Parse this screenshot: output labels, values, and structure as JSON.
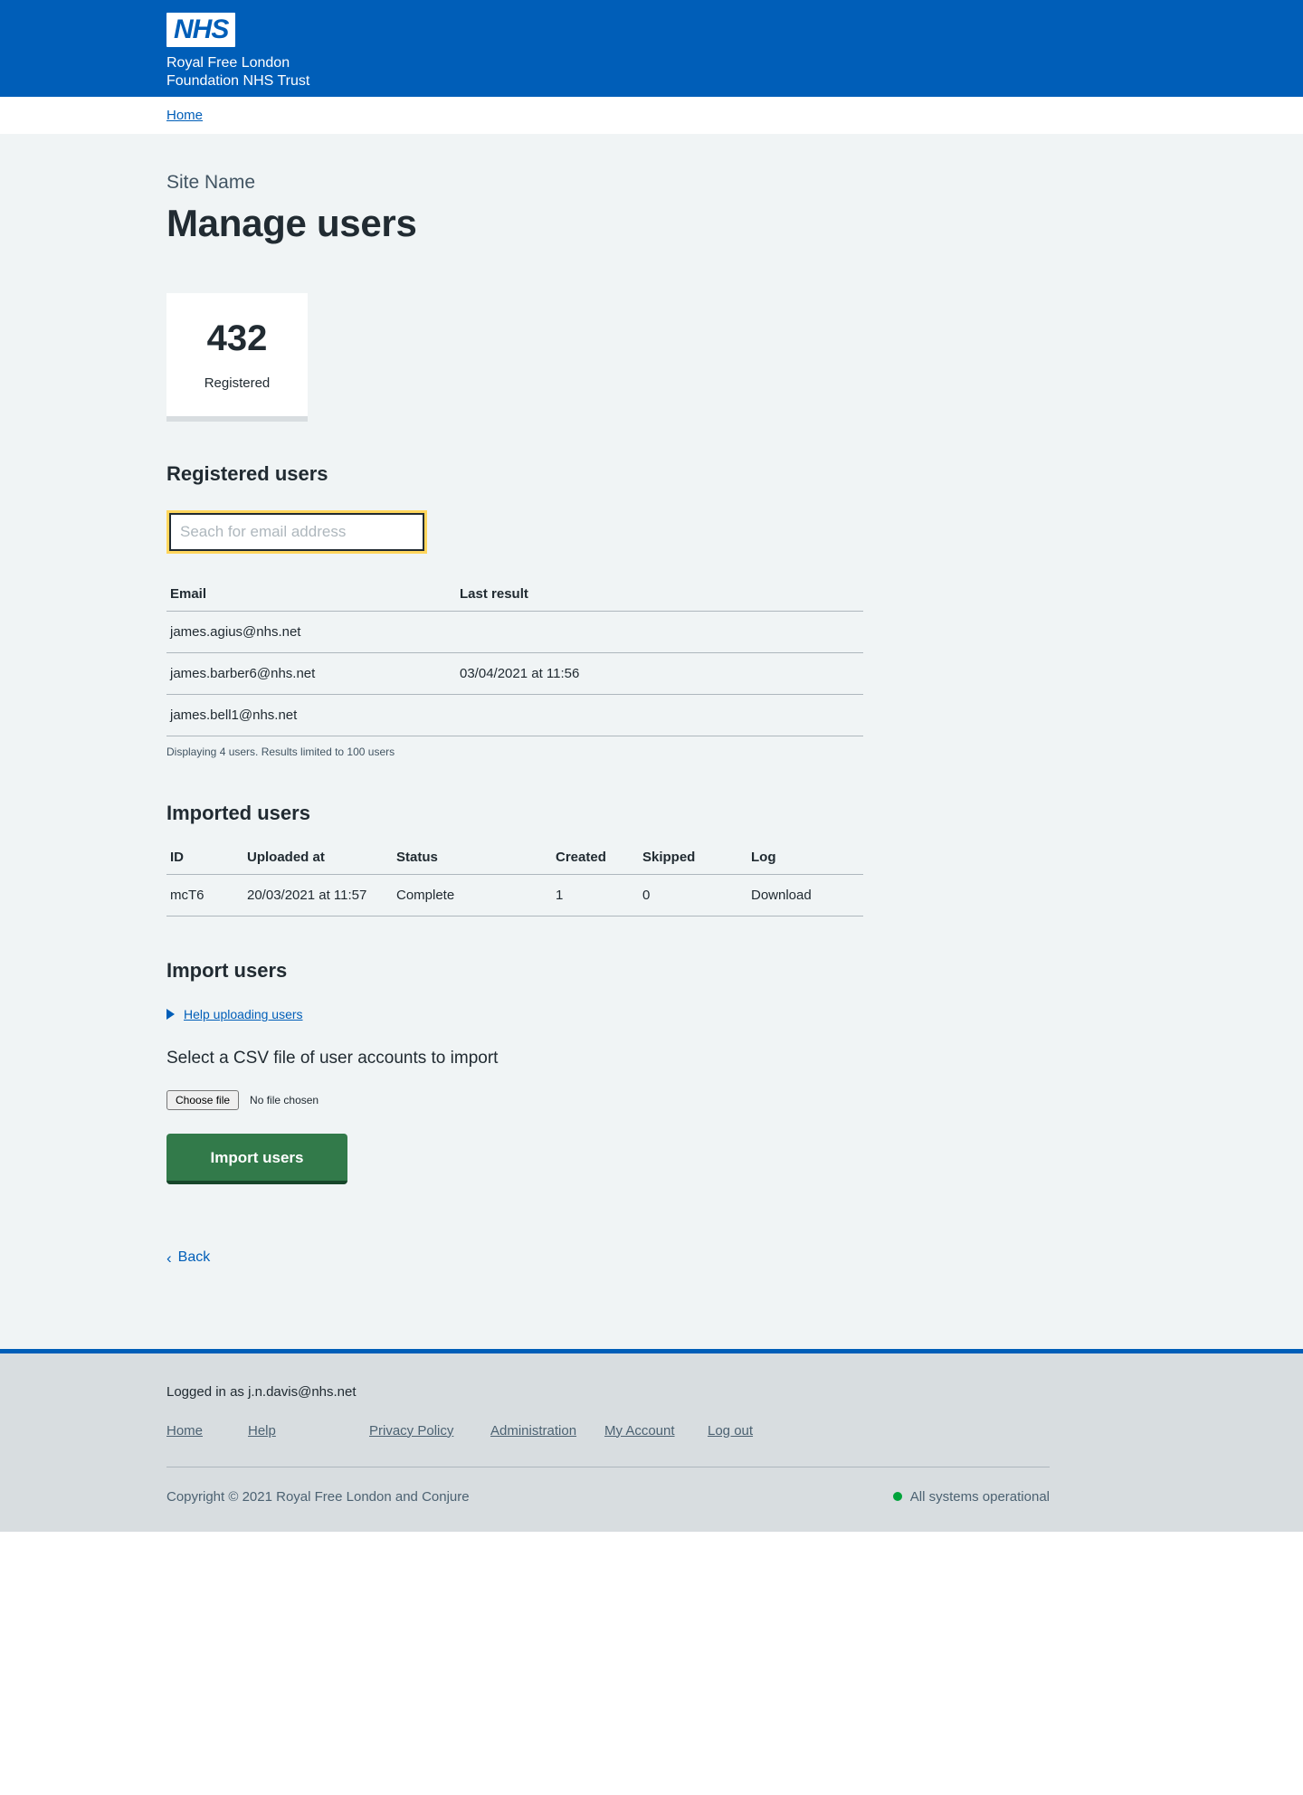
{
  "header": {
    "logo_text": "NHS",
    "trust_line1": "Royal Free London",
    "trust_line2": "Foundation NHS Trust"
  },
  "breadcrumb": {
    "home_label": "Home"
  },
  "page": {
    "site_name": "Site Name",
    "title": "Manage users"
  },
  "stat_card": {
    "value": "432",
    "label": "Registered"
  },
  "registered_users": {
    "heading": "Registered users",
    "search_placeholder": "Seach for email address",
    "search_value": "",
    "columns": [
      "Email",
      "Last result"
    ],
    "rows": [
      {
        "email": "james.agius@nhs.net",
        "last_result": ""
      },
      {
        "email": "james.barber6@nhs.net",
        "last_result": "03/04/2021 at 11:56"
      },
      {
        "email": "james.bell1@nhs.net",
        "last_result": ""
      }
    ],
    "caption": "Displaying 4 users. Results limited to 100 users"
  },
  "imported_users": {
    "heading": "Imported users",
    "columns": [
      "ID",
      "Uploaded at",
      "Status",
      "Created",
      "Skipped",
      "Log"
    ],
    "rows": [
      {
        "id": "mcT6",
        "uploaded_at": "20/03/2021 at 11:57",
        "status": "Complete",
        "created": "1",
        "skipped": "0",
        "log": "Download"
      }
    ]
  },
  "import_users": {
    "heading": "Import users",
    "help_summary": "Help uploading users",
    "field_label": "Select a CSV file of user accounts to import",
    "file_button_label": "Choose file",
    "file_status": "No file chosen",
    "submit_label": "Import users"
  },
  "back": {
    "chevron": "‹",
    "label": "Back"
  },
  "footer": {
    "logged_in": "Logged in as j.n.davis@nhs.net",
    "links": [
      {
        "label": "Home"
      },
      {
        "label": "Help"
      },
      {
        "label": "Privacy Policy"
      },
      {
        "label": "Administration"
      },
      {
        "label": "My Account"
      },
      {
        "label": "Log out"
      }
    ],
    "copyright": "Copyright © 2021 Royal Free London and Conjure",
    "status_text": "All systems operational",
    "status_color": "#00a33b"
  }
}
